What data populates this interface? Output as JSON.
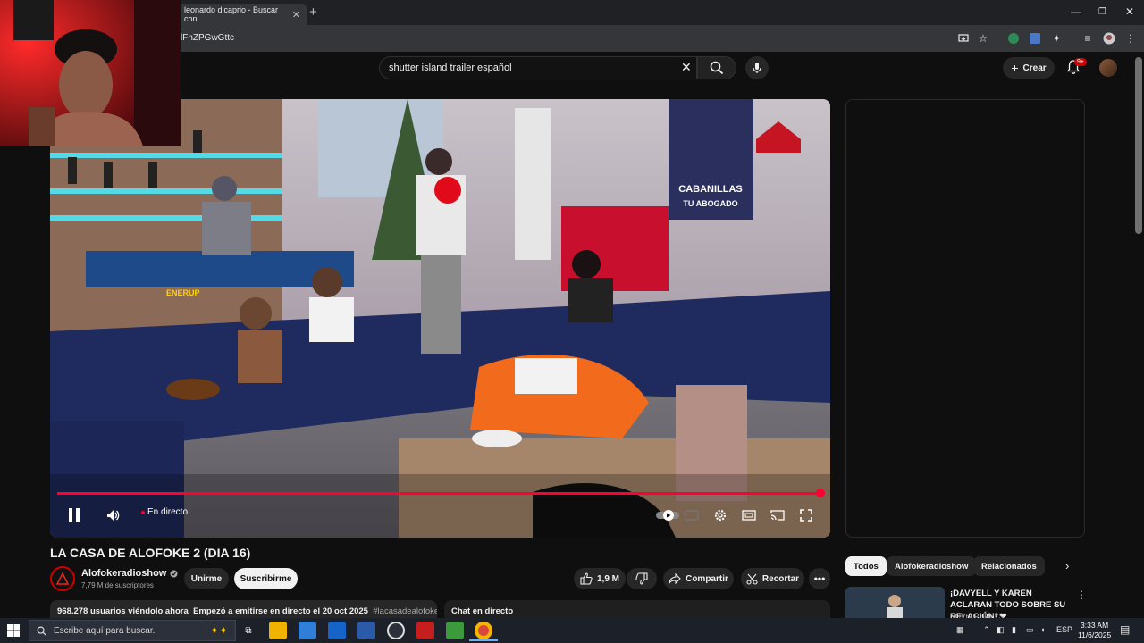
{
  "browser": {
    "tab_title": "leonardo dicaprio - Buscar con",
    "url_fragment": "lFnZPGwGttc"
  },
  "header": {
    "search_query": "shutter island trailer español",
    "create_label": "Crear",
    "notification_badge": "9+"
  },
  "video": {
    "title": "LA CASA DE ALOFOKE 2 (DIA 16)",
    "live_label": "En directo",
    "progress": 1.0,
    "scene_sign_brand": "CABANILLAS",
    "scene_sign_tagline": "TU ABOGADO",
    "scene_table_brand": "ENERUP"
  },
  "channel": {
    "name": "Alofokeradioshow",
    "subscribers": "7,79 M de suscriptores",
    "join_label": "Unirme",
    "subscribe_label": "Suscribirme"
  },
  "actions": {
    "likes": "1,9 M",
    "share_label": "Compartir",
    "clip_label": "Recortar"
  },
  "description": {
    "viewers": "968.278 usuarios viéndolo ahora",
    "started": "Empezó a emitirse en directo el 20 oct 2025",
    "hashtag": "#lacasadealofoke"
  },
  "chat": {
    "label": "Chat en directo"
  },
  "chips": [
    "Todos",
    "Alofokeradioshow",
    "Relacionados"
  ],
  "recommendation": {
    "title": "¡DAVYELL Y KAREN ACLARAN TODO SOBRE SU RELACIÓN! ❤",
    "channel": "NOVELPOPPYS"
  },
  "taskbar": {
    "search_placeholder": "Escribe aquí para buscar.",
    "language": "ESP",
    "time": "3:33 AM",
    "date": "11/6/2025"
  },
  "colors": {
    "accent": "#ff0033",
    "background": "#0f0f0f",
    "chip": "#272727"
  }
}
